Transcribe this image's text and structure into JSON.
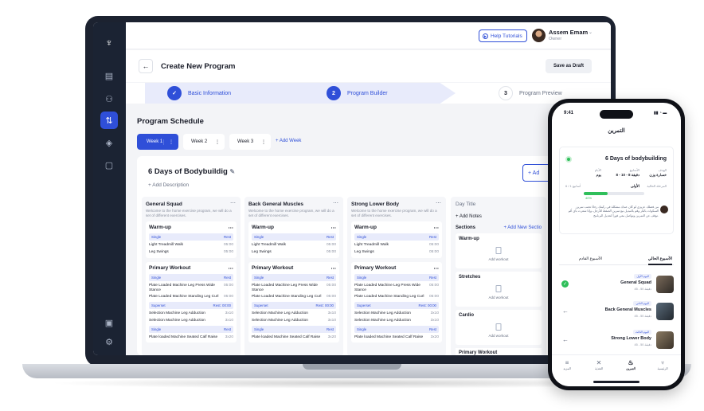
{
  "header": {
    "help_label": "Help Tutorials",
    "user_name": "Assem Emam",
    "user_role": "Owner",
    "title": "Create New Program",
    "save_draft": "Save as Draft"
  },
  "steps": [
    {
      "num": "1",
      "label": "Basic Information",
      "state": "done"
    },
    {
      "num": "2",
      "label": "Program Builder",
      "state": "active"
    },
    {
      "num": "3",
      "label": "Program Preview",
      "state": "pending"
    }
  ],
  "schedule": {
    "title": "Program Schedule",
    "weeks": [
      "Week 1",
      "Week 2",
      "Week 3"
    ],
    "add_week": "+ Add Week"
  },
  "program": {
    "name": "6 Days of Bodybuildig",
    "add_desc": "+ Add Description",
    "add_btn": "+ Ad"
  },
  "days": [
    {
      "title": "General Squad",
      "desc": "Welcome to the home exercise program, we will do a set of different exercises.",
      "warmup": "Warm-up",
      "warm_set": "Single",
      "warm_rest": "Rest",
      "warm_ex": [
        {
          "n": "Light Treadmill Walk",
          "v": "05:00"
        },
        {
          "n": "Leg Swings",
          "v": "05:00"
        }
      ],
      "primary": "Primary Workout",
      "p_set": "Single",
      "p_rest": "Rest",
      "p_ex1": [
        {
          "n": "Plate Loaded Machine Leg Press Wide Stance",
          "v": "05:00"
        },
        {
          "n": "Plate Loaded Machine Standing Leg Curl",
          "v": "05:00"
        }
      ],
      "super": "Superset",
      "super_rest": "Rest: 00:00",
      "p_ex2": [
        {
          "n": "Selection Machine Leg Adduction",
          "v": "3x10"
        },
        {
          "n": "Selection Machine Leg Adduction",
          "v": "3x10"
        }
      ],
      "p_set2": "Single",
      "p_rest2": "Rest",
      "last_ex": {
        "n": "Plate loaded Machine Seated Calf Raise",
        "v": "3x20"
      }
    },
    {
      "title": "Back General Muscles",
      "desc": "Welcome to the home exercise program, we will do a set of different exercises.",
      "warmup": "Warm-up",
      "warm_set": "Single",
      "warm_rest": "Rest",
      "warm_ex": [
        {
          "n": "Light Treadmill Walk",
          "v": "05:00"
        },
        {
          "n": "Leg Swings",
          "v": "05:00"
        }
      ],
      "primary": "Primary Workout",
      "p_set": "Single",
      "p_rest": "Rest",
      "p_ex1": [
        {
          "n": "Plate Loaded Machine Leg Press Wide Stance",
          "v": "05:00"
        },
        {
          "n": "Plate Loaded Machine Standing Leg Curl",
          "v": "05:00"
        }
      ],
      "super": "Superset",
      "super_rest": "Rest: 00:00",
      "p_ex2": [
        {
          "n": "Selection Machine Leg Adduction",
          "v": "3x10"
        },
        {
          "n": "Selection Machine Leg Adduction",
          "v": "3x10"
        }
      ],
      "p_set2": "Single",
      "p_rest2": "Rest",
      "last_ex": {
        "n": "Plate loaded Machine Seated Calf Raise",
        "v": "3x20"
      }
    },
    {
      "title": "Strong Lower Body",
      "desc": "Welcome to the home exercise program, we will do a set of different exercises.",
      "warmup": "Warm-up",
      "warm_set": "Single",
      "warm_rest": "Rest",
      "warm_ex": [
        {
          "n": "Light Treadmill Walk",
          "v": "05:00"
        },
        {
          "n": "Leg Swings",
          "v": "05:00"
        }
      ],
      "primary": "Primary Workout",
      "p_set": "Single",
      "p_rest": "Rest",
      "p_ex1": [
        {
          "n": "Plate Loaded Machine Leg Press Wide Stance",
          "v": "05:00"
        },
        {
          "n": "Plate Loaded Machine Standing Leg Curl",
          "v": "05:00"
        }
      ],
      "super": "Superset",
      "super_rest": "Rest: 00:00",
      "p_ex2": [
        {
          "n": "Selection Machine Leg Adduction",
          "v": "3x10"
        },
        {
          "n": "Selection Machine Leg Adduction",
          "v": "3x10"
        }
      ],
      "p_set2": "Single",
      "p_rest2": "Rest",
      "last_ex": {
        "n": "Plate loaded Machine Seated Calf Raise",
        "v": "3x20"
      }
    }
  ],
  "new_day": {
    "title": "Day Title",
    "add_notes": "+ Add Notes",
    "sections": "Sections",
    "add_section": "+ Add New Sectio",
    "boxes": [
      "Warm-up",
      "Stretches",
      "Cardio"
    ],
    "add_workout": "Add workout",
    "primary": "Primary Workout"
  },
  "phone": {
    "time": "9:41",
    "title": "التمرين",
    "program": "6 Days of bodybuilding",
    "meta": [
      {
        "k": "الهدف",
        "v": "خسارة وزن"
      },
      {
        "k": "الأسابيع",
        "v": "8 - 10 - 8 دقيقة"
      },
      {
        "k": "الأيام",
        "v": "يوم"
      }
    ],
    "stage": "المرحلة الحالية",
    "stage_val": "الأولى",
    "week_progress": "6 / 1 أسابيع",
    "progress_pct": 0.4,
    "progress_label": "40%",
    "note": "من فضلك عزيزي لو كان عندك مشكلة في ركبتك رجاءً تجنب تمرين السكوات بالبار وقم بالتبديل مع تمرين الضغط للأرجل، وإذا شعرت بأي ألم توقف عن التمرين وتواصل معي فوراً لتعديل البرنامج.",
    "tabs": [
      "الأسبوع الحالي",
      "الأسبوع القادم"
    ],
    "days": [
      {
        "badge": "اليوم الأول",
        "name": "General Squad",
        "dur": "45 - 50 دقيقة",
        "done": true
      },
      {
        "badge": "اليوم الثاني",
        "name": "Back General Muscles",
        "dur": "45 - 50 دقيقة",
        "done": false
      },
      {
        "badge": "اليوم الثالث",
        "name": "Strong Lower Body",
        "dur": "45 - 50 دقيقة",
        "done": false
      }
    ],
    "nav": [
      "الرئيسية",
      "التمرين",
      "التغذية",
      "المزيد"
    ]
  }
}
